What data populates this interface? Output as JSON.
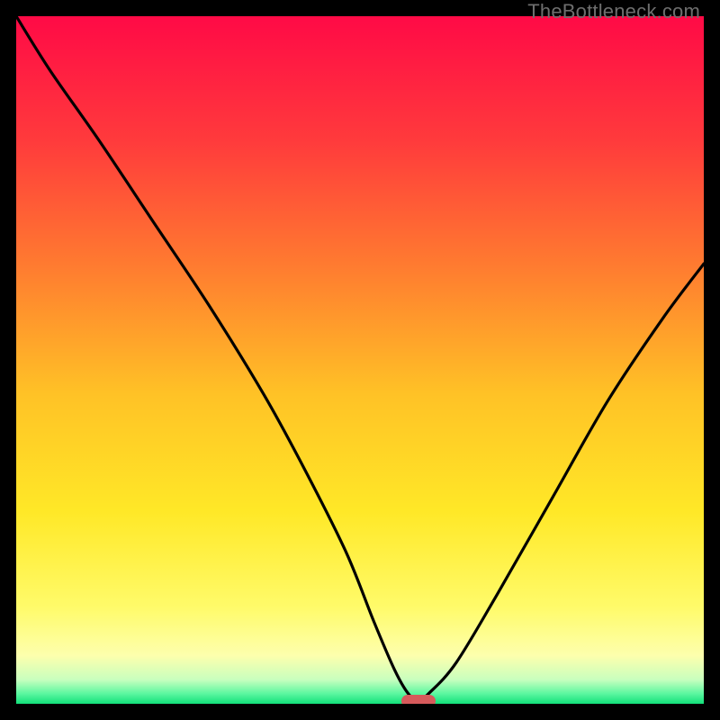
{
  "watermark": "TheBottleneck.com",
  "chart_data": {
    "type": "line",
    "title": "",
    "xlabel": "",
    "ylabel": "",
    "xlim": [
      0,
      100
    ],
    "ylim": [
      0,
      100
    ],
    "series": [
      {
        "name": "bottleneck-curve",
        "x": [
          0,
          5,
          12,
          20,
          28,
          36,
          42,
          48,
          52,
          55,
          57,
          58.5,
          60,
          64,
          70,
          78,
          86,
          94,
          100
        ],
        "y": [
          100,
          92,
          82,
          70,
          58,
          45,
          34,
          22,
          12,
          5,
          1.5,
          0.5,
          1.5,
          6,
          16,
          30,
          44,
          56,
          64
        ]
      }
    ],
    "marker": {
      "x": 58.5,
      "y": 0.4,
      "color": "#d65a5b"
    },
    "background_gradient": {
      "stops": [
        {
          "pos": 0.0,
          "color": "#ff0a46"
        },
        {
          "pos": 0.18,
          "color": "#ff3a3c"
        },
        {
          "pos": 0.36,
          "color": "#ff7a30"
        },
        {
          "pos": 0.55,
          "color": "#ffc226"
        },
        {
          "pos": 0.72,
          "color": "#ffe827"
        },
        {
          "pos": 0.86,
          "color": "#fffb6a"
        },
        {
          "pos": 0.93,
          "color": "#fdffad"
        },
        {
          "pos": 0.965,
          "color": "#c8ffbe"
        },
        {
          "pos": 0.985,
          "color": "#5cf7a0"
        },
        {
          "pos": 1.0,
          "color": "#12e07a"
        }
      ]
    }
  }
}
